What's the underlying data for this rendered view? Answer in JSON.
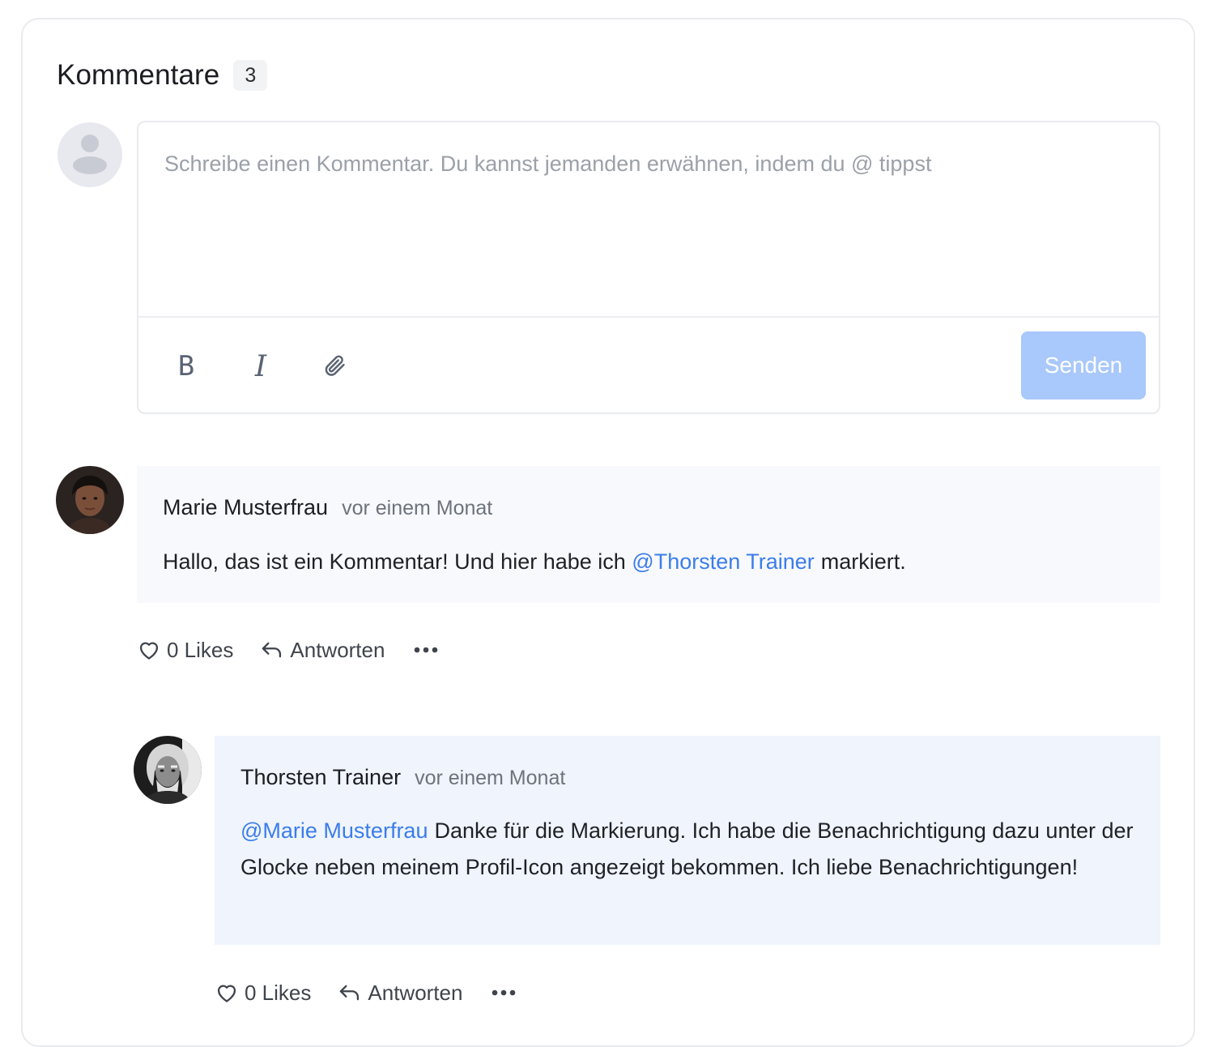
{
  "header": {
    "title": "Kommentare",
    "count": "3"
  },
  "composer": {
    "placeholder": "Schreibe einen Kommentar. Du kannst jemanden erwähnen, indem du @ tippst",
    "value": "",
    "toolbar": {
      "bold_icon": "bold-icon",
      "italic_icon": "italic-icon",
      "attach_icon": "paperclip-icon"
    },
    "send_label": "Senden"
  },
  "comments": [
    {
      "author": "Marie Musterfrau",
      "time": "vor einem Monat",
      "text_before": "Hallo, das ist ein Kommentar! Und hier habe ich ",
      "mention": "@Thorsten Trainer",
      "text_after": "markiert.",
      "likes_label": "0 Likes",
      "reply_label": "Antworten"
    },
    {
      "author": "Thorsten Trainer",
      "time": "vor einem Monat",
      "mention": "@Marie Musterfrau",
      "text_after": "Danke für die Markierung. Ich habe die Benachrichtigung dazu unter der Glocke neben meinem Profil-Icon angezeigt bekommen. Ich liebe Benachrichtigungen!",
      "likes_label": "0 Likes",
      "reply_label": "Antworten"
    }
  ],
  "colors": {
    "accent": "#3b7dea",
    "send_disabled": "#a9c8fb",
    "comment_bg": "#f8f9fc",
    "reply_bg": "#eff4fd"
  }
}
